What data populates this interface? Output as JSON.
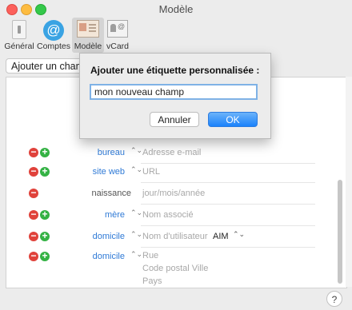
{
  "window": {
    "title": "Modèle"
  },
  "toolbar": {
    "items": [
      {
        "label": "Général",
        "icon": "general-icon",
        "selected": false
      },
      {
        "label": "Comptes",
        "icon": "at-icon",
        "selected": false
      },
      {
        "label": "Modèle",
        "icon": "template-icon",
        "selected": true
      },
      {
        "label": "vCard",
        "icon": "vcard-icon",
        "selected": false
      }
    ]
  },
  "add_field": {
    "label": "Ajouter un champ"
  },
  "sheet": {
    "title": "Ajouter une étiquette personnalisée :",
    "input_value": "mon nouveau champ",
    "cancel_label": "Annuler",
    "ok_label": "OK"
  },
  "fields": [
    {
      "label": "bureau",
      "placeholder": "Adresse e-mail"
    },
    {
      "label": "site web",
      "placeholder": "URL"
    },
    {
      "label": "naissance",
      "placeholder": "jour/mois/année"
    },
    {
      "label": "mère",
      "placeholder": "Nom associé"
    },
    {
      "label": "domicile",
      "placeholder": "Nom d'utilisateur",
      "service": "AIM"
    },
    {
      "label": "domicile",
      "placeholder_lines": [
        "Rue",
        "Code postal Ville",
        "Pays"
      ]
    }
  ],
  "help": {
    "label": "?"
  },
  "icons": {
    "at_symbol": "@",
    "chevron": "⌃⌄",
    "minus": "−",
    "plus": "+"
  },
  "colors": {
    "accent_blue": "#2f7ad6",
    "delete_red": "#e0423b",
    "add_green": "#34b244",
    "ok_button": "#1a82fb"
  }
}
